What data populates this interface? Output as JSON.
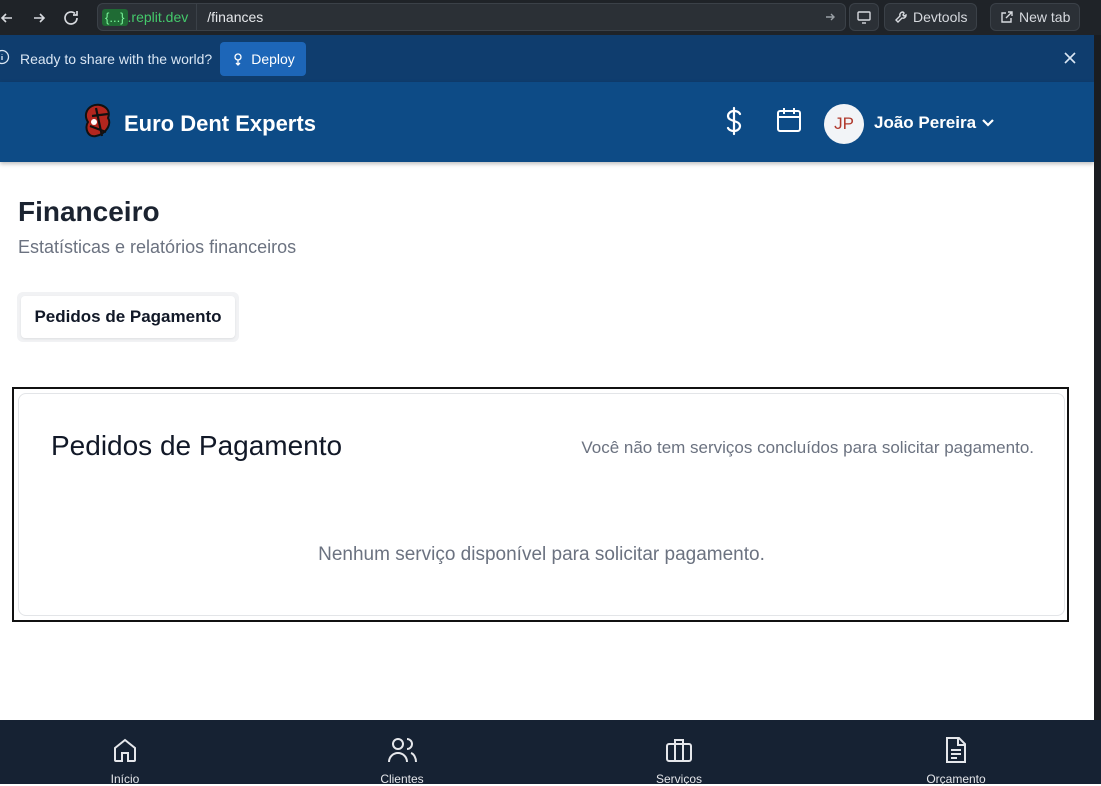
{
  "browser": {
    "url_badge": "{...}",
    "url_domain": ".replit.dev",
    "url_path": "/finances",
    "devtools_label": "Devtools",
    "new_tab_label": "New tab"
  },
  "banner": {
    "text": "Ready to share with the world?",
    "deploy_label": "Deploy"
  },
  "header": {
    "brand": "Euro Dent Experts",
    "avatar_initials": "JP",
    "user_name": "João Pereira"
  },
  "page": {
    "title": "Financeiro",
    "subtitle": "Estatísticas e relatórios financeiros",
    "tab_label": "Pedidos de Pagamento"
  },
  "card": {
    "title": "Pedidos de Pagamento",
    "note": "Você não tem serviços concluídos para solicitar pagamento.",
    "empty": "Nenhum serviço disponível para solicitar pagamento."
  },
  "bottom_nav": [
    {
      "label": "Início",
      "icon": "home-icon"
    },
    {
      "label": "Clientes",
      "icon": "users-icon"
    },
    {
      "label": "Serviços",
      "icon": "briefcase-icon"
    },
    {
      "label": "Orçamento",
      "icon": "document-icon"
    }
  ],
  "colors": {
    "header_bg": "#0d4b86",
    "banner_bg": "#0f3d6e",
    "deploy_button": "#1d66b8",
    "bottom_nav_bg": "#162233"
  }
}
